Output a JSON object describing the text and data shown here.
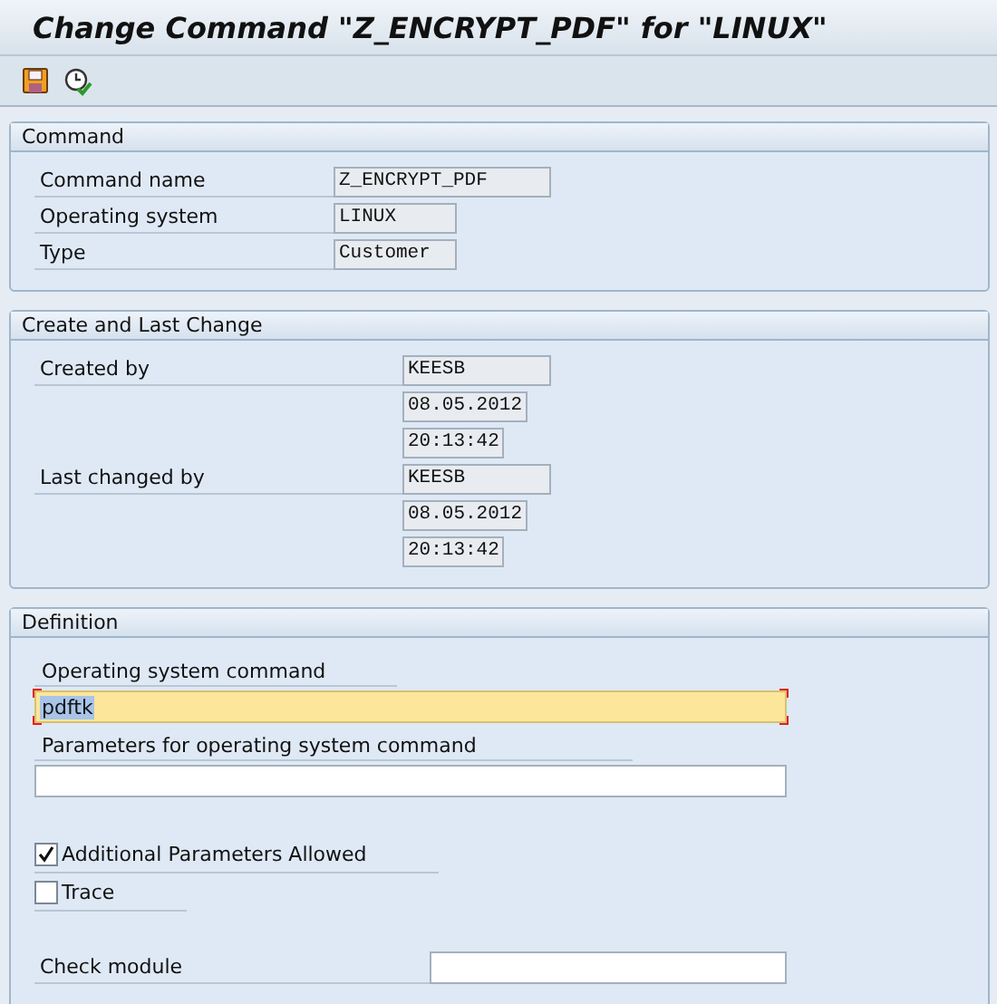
{
  "window": {
    "title": "Change Command \"Z_ENCRYPT_PDF\" for \"LINUX\""
  },
  "sections": [
    {
      "title": "Command",
      "fields": [
        {
          "label": "Command name",
          "value": "Z_ENCRYPT_PDF"
        },
        {
          "label": "Operating system",
          "value": "LINUX"
        },
        {
          "label": "Type",
          "value": "Customer"
        }
      ]
    },
    {
      "title": "Create and Last Change",
      "fields": [
        {
          "label": "Created by",
          "value": "KEESB"
        },
        {
          "value": "08.05.2012"
        },
        {
          "value": "20:13:42"
        },
        {
          "label": "Last changed by",
          "value": "KEESB"
        },
        {
          "value": "08.05.2012"
        },
        {
          "value": "20:13:42"
        }
      ]
    }
  ],
  "definition": {
    "title": "Definition",
    "items": [
      {
        "kind": "label",
        "label": "Operating system command"
      },
      {
        "kind": "input",
        "value": "pdftk",
        "focused": true
      },
      {
        "kind": "label",
        "label": "Parameters for operating system command"
      },
      {
        "kind": "input",
        "focused": false
      },
      {
        "kind": "checkbox",
        "label": "Additional Parameters Allowed",
        "checked": true
      },
      {
        "kind": "checkbox",
        "label": "Trace",
        "checked": false
      },
      {
        "kind": "inline",
        "label": "Check module"
      }
    ]
  }
}
